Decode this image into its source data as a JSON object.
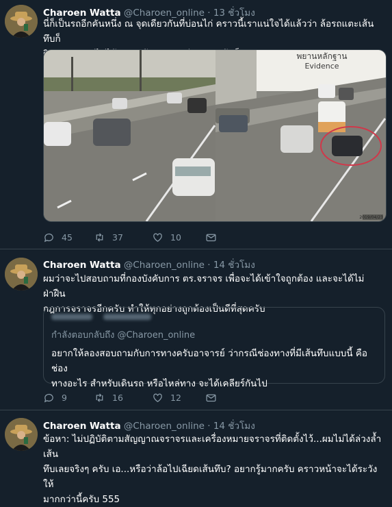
{
  "tweets": [
    {
      "author_name": "Charoen Watta",
      "handle": "@Charoen_online",
      "separator": "·",
      "time": "13 ชั่วโมง",
      "text_lines": [
        "นี่ก็เป็นรถอีกคันหนึ่ง ณ จุดเดียวกันที่บ่อนไก่ คราวนี้เราแน่ใจได้แล้วว่า ล้อรถแตะเส้นทึบก็",
        "ผิดกฎจราจร ไม่ได้ขับฝ่าเส้นทึบ แค่เฉียดแตะเส้นก็ผิดครับ!"
      ],
      "media": {
        "evidence_title": "พยานหลักฐาน",
        "evidence_subtitle": "Evidence",
        "image_stamp": "2019/04/23"
      },
      "reply_count": "45",
      "retweet_count": "37",
      "like_count": "10"
    },
    {
      "author_name": "Charoen Watta",
      "handle": "@Charoen_online",
      "separator": "·",
      "time": "14 ชั่วโมง",
      "text_lines": [
        "ผมว่าจะไปสอบถามที่กองบังคับการ ตร.จราจร เพื่อจะได้เข้าใจถูกต้อง และจะได้ไม่ฝ่าฝืน",
        "กฎการจราจรอีกครับ ทำให้ทุกอย่างถูกต้องเป็นดีที่สุดครับ"
      ],
      "quote": {
        "replying_to_label": "กำลังตอบกลับถึง",
        "replying_to_handle": "@Charoen_online",
        "text_lines": [
          "อยากให้ลองสอบถามกับการทางครับอาจารย์ ว่ากรณีช่องทางที่มีเส้นทึบแบบนี้ คือช่อง",
          "ทางอะไร สำหรับเดินรถ หรือไหล่ทาง จะได้เคลียร์กันไป"
        ]
      },
      "reply_count": "9",
      "retweet_count": "16",
      "like_count": "12"
    },
    {
      "author_name": "Charoen Watta",
      "handle": "@Charoen_online",
      "separator": "·",
      "time": "14 ชั่วโมง",
      "text_lines": [
        "ข้อหา: ไม่ปฏิบัติตามสัญญาณจราจรและเครื่องหมายจราจรที่ติดตั้งไว้...ผมไม่ได้ล่วงล้ำเส้น",
        "ทึบเลยจริงๆ ครับ เอ...หรือว่าล้อไปเฉียดเส้นทึบ? อยากรู้มากครับ คราวหน้าจะได้ระวังให้",
        "มากกว่านี้ครับ 555"
      ]
    }
  ],
  "colors": {
    "background": "#15202b",
    "secondary_text": "#8899a6",
    "border": "#38444d",
    "evidence_circle": "#d0384a"
  }
}
